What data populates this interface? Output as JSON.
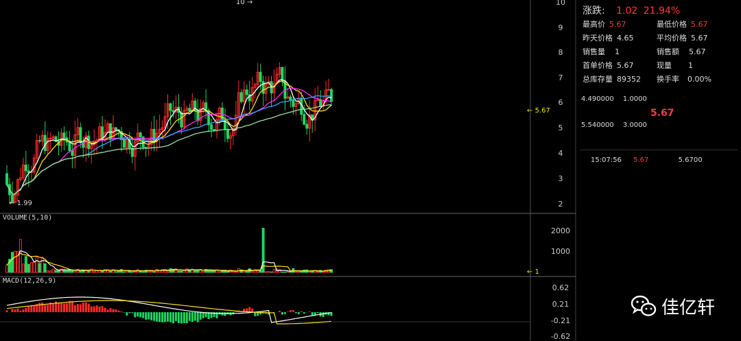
{
  "main_chart": {
    "price_axis_ticks": [
      "10",
      "9",
      "8",
      "7",
      "6",
      "5",
      "4",
      "3",
      "2"
    ],
    "high_annotation": "10",
    "low_annotation": "1.99",
    "current_price_annotation": "5.67",
    "colors": {
      "up": "#ff2b2b",
      "down": "#1ed760",
      "ma5": "#ffffff",
      "ma10": "#ffe11a",
      "ma20": "#ff2bff",
      "ma30": "#2fa9ff",
      "ma60": "#9be29b"
    }
  },
  "volume_panel": {
    "label": "VOLUME(5,10)",
    "ticks": [
      "2000",
      "1000"
    ],
    "current_annotation": "1"
  },
  "macd_panel": {
    "label": "MACD(12,26,9)",
    "ticks": [
      "0.62",
      "0.21",
      "-0.21",
      "-0.62"
    ]
  },
  "sidebar": {
    "change_label": "涨跌:",
    "change_value": "1.02",
    "change_pct": "21.94%",
    "stats": [
      {
        "label": "最高价",
        "value": "5.67",
        "red": true
      },
      {
        "label": "最低价格",
        "value": "5.67",
        "red": true
      },
      {
        "label": "昨天价格",
        "value": "4.65",
        "red": false
      },
      {
        "label": "平均价格",
        "value": "5.67",
        "red": false
      },
      {
        "label": "销售量",
        "value": "1",
        "red": false
      },
      {
        "label": "销售额",
        "value": "5.67",
        "red": false
      },
      {
        "label": "首单价格",
        "value": "5.67",
        "red": false
      },
      {
        "label": "现量",
        "value": "1",
        "red": false
      },
      {
        "label": "总库存量",
        "value": "89352",
        "red": false
      },
      {
        "label": "换手率",
        "value": "0.00%",
        "red": false
      }
    ],
    "ask_price": "4.490000",
    "ask_qty": "1.0000",
    "mid_price": "5.67",
    "bid_price": "5.540000",
    "bid_qty": "3.0000",
    "trade_time": "15:07:56",
    "trade_price": "5.67",
    "trade_value": "5.6700"
  },
  "watermark": {
    "text": "佳亿轩",
    "icon": "wechat-icon"
  }
}
